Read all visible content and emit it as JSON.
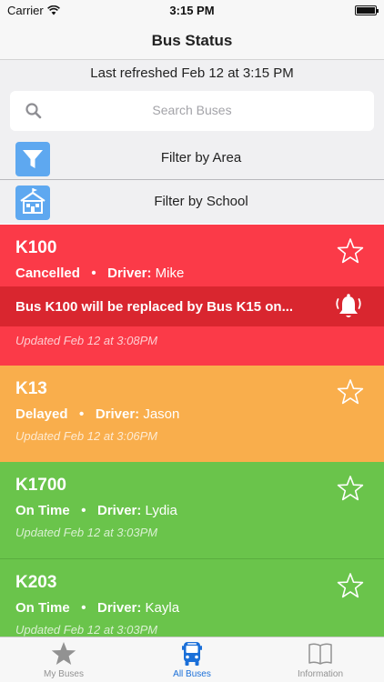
{
  "status_bar": {
    "carrier": "Carrier",
    "time": "3:15 PM"
  },
  "nav": {
    "title": "Bus Status"
  },
  "refresh": {
    "text": "Last refreshed Feb 12 at 3:15 PM"
  },
  "search": {
    "placeholder": "Search Buses"
  },
  "filters": [
    {
      "label": "Filter by Area",
      "icon": "funnel-icon"
    },
    {
      "label": "Filter by School",
      "icon": "school-icon"
    }
  ],
  "colors": {
    "cancelled": "#fb3a48",
    "delayed": "#f9ae4c",
    "on_time": "#6ac44b",
    "alert": "#d9262f",
    "accent": "#1a6fd8"
  },
  "buses": [
    {
      "name": "K100",
      "status": "Cancelled",
      "driver_label": "Driver:",
      "driver": "Mike",
      "alert": "Bus K100 will be replaced by Bus K15 on...",
      "updated": "Updated Feb 12 at 3:08PM"
    },
    {
      "name": "K13",
      "status": "Delayed",
      "driver_label": "Driver:",
      "driver": "Jason",
      "updated": "Updated Feb 12 at 3:06PM"
    },
    {
      "name": "K1700",
      "status": "On Time",
      "driver_label": "Driver:",
      "driver": "Lydia",
      "updated": "Updated Feb 12 at 3:03PM"
    },
    {
      "name": "K203",
      "status": "On Time",
      "driver_label": "Driver:",
      "driver": "Kayla",
      "updated": "Updated Feb 12 at 3:03PM"
    }
  ],
  "tabs": [
    {
      "label": "My Buses",
      "icon": "star-icon"
    },
    {
      "label": "All Buses",
      "icon": "bus-icon",
      "active": true
    },
    {
      "label": "Information",
      "icon": "book-icon"
    }
  ]
}
